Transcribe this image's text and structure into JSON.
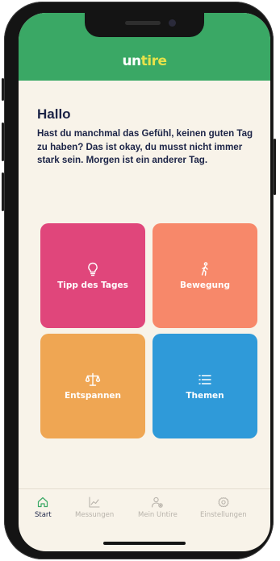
{
  "app": {
    "logo_part1": "un",
    "logo_part2": "tire"
  },
  "greeting": {
    "title": "Hallo",
    "text": "Hast du manchmal das Gefühl, keinen guten Tag zu haben? Das ist okay, du musst nicht immer stark sein. Morgen ist ein anderer Tag."
  },
  "tiles": [
    {
      "label": "Tipp des Tages",
      "icon": "lightbulb-icon",
      "color": "#e0467b"
    },
    {
      "label": "Bewegung",
      "icon": "walking-person-icon",
      "color": "#f7886a"
    },
    {
      "label": "Entspannen",
      "icon": "scales-icon",
      "color": "#efa653"
    },
    {
      "label": "Themen",
      "icon": "list-icon",
      "color": "#2f9ad9"
    }
  ],
  "nav": {
    "items": [
      {
        "label": "Start",
        "icon": "home-icon",
        "active": true
      },
      {
        "label": "Messungen",
        "icon": "chart-icon",
        "active": false
      },
      {
        "label": "Mein Untire",
        "icon": "profile-settings-icon",
        "active": false
      },
      {
        "label": "Einstellungen",
        "icon": "gear-icon",
        "active": false
      }
    ],
    "active_color": "#3aa865",
    "inactive_color": "#b8b3ab"
  },
  "colors": {
    "header": "#3aa865",
    "background": "#f8f3e9",
    "text": "#1c2447"
  }
}
